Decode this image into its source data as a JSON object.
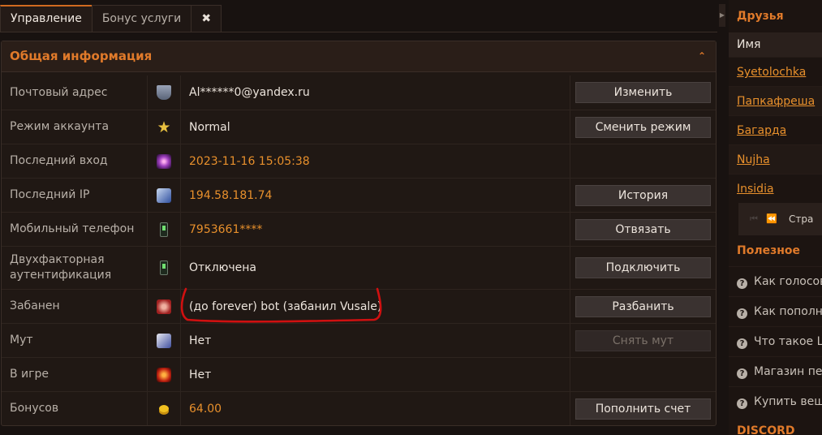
{
  "tabs": [
    {
      "label": "Управление",
      "active": true
    },
    {
      "label": "Бонус услуги",
      "active": false
    }
  ],
  "close_tab_glyph": "✖",
  "panel": {
    "title": "Общая информация",
    "collapse_glyph": "⌃",
    "rows": [
      {
        "label": "Почтовый адрес",
        "icon": "shield-icon",
        "value": "Al******0@yandex.ru",
        "value_color": "white",
        "action": "Изменить"
      },
      {
        "label": "Режим аккаунта",
        "icon": "star-icon",
        "value": "Normal",
        "value_color": "white",
        "action": "Сменить режим"
      },
      {
        "label": "Последний вход",
        "icon": "login-icon",
        "value": "2023-11-16 15:05:38",
        "value_color": "orange",
        "action": ""
      },
      {
        "label": "Последний IP",
        "icon": "network-icon",
        "value": "194.58.181.74",
        "value_color": "orange",
        "action": "История"
      },
      {
        "label": "Мобильный телефон",
        "icon": "phone-icon",
        "value": "7953661****",
        "value_color": "orange",
        "action": "Отвязать"
      },
      {
        "label": "Двухфакторная аутентификация",
        "icon": "phone-2fa-icon",
        "value": "Отключена",
        "value_color": "white",
        "action": "Подключить"
      },
      {
        "label": "Забанен",
        "icon": "ban-icon",
        "value": "(до forever) bot (забанил Vusale)",
        "value_color": "white",
        "action": "Разбанить"
      },
      {
        "label": "Мут",
        "icon": "mute-icon",
        "value": "Нет",
        "value_color": "white",
        "action": "Снять мут",
        "action_disabled": true
      },
      {
        "label": "В игре",
        "icon": "ingame-icon",
        "value": "Нет",
        "value_color": "white",
        "action": ""
      },
      {
        "label": "Бонусов",
        "icon": "coin-icon",
        "value": "64.00",
        "value_color": "orange",
        "action": "Пополнить счет"
      }
    ]
  },
  "sidebar": {
    "friends_title": "Друзья",
    "friends_column": "Имя",
    "friends": [
      "Syetolochka",
      "Папкафреша",
      "Багарда",
      "Nujha",
      "Insidia"
    ],
    "pager_label": "Стра",
    "useful_title": "Полезное",
    "useful_items": [
      "Как голосова",
      "Как пополни",
      "Что такое Lo",
      "Магазин пер",
      "Купить вещь"
    ],
    "discord_title": "DISCORD"
  },
  "colors": {
    "accent": "#e07a2a",
    "value_orange": "#e8902c",
    "background": "#181210",
    "annotation_red": "#d01010"
  }
}
